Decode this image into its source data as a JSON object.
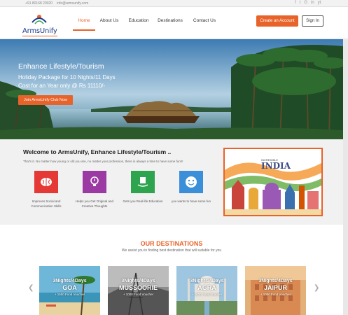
{
  "topbar": {
    "phone": "+91 80168 29020",
    "email": "info@armsunify.com",
    "social": [
      "f",
      "t",
      "G",
      "in",
      "yt"
    ]
  },
  "brand": {
    "name": "ArmsUnify"
  },
  "nav": {
    "items": [
      "Home",
      "About Us",
      "Education",
      "Destinations",
      "Contact Us"
    ],
    "active": "Home"
  },
  "auth": {
    "create_label": "Create an Account",
    "signin_label": "Sign In"
  },
  "hero": {
    "title": "Enhance Lifestyle/Tourism",
    "line1": "Holiday Package for 10 Nights/11 Days",
    "line2": "Cost for an Year only @ Rs 11110/-",
    "cta": "Join ArmsUnify Club Now"
  },
  "welcome": {
    "title": "Welcome to ArmsUnify, Enhance Lifestyle/Tourism ..",
    "desc": "That's it. No matter how young or old you are, no matter your profession, there is always a time to have some fun!!!",
    "features": [
      {
        "label": "Improves Social and Communication Skills",
        "color": "#e53935",
        "icon": "brain-icon"
      },
      {
        "label": "Helps you Get Original and Creative Thoughts",
        "color": "#9c3aa4",
        "icon": "lightbulb-icon"
      },
      {
        "label": "Gets you Real-life Education",
        "color": "#2ea44f",
        "icon": "book-hand-icon"
      },
      {
        "label": "you wants to have some fun",
        "color": "#3a8fd8",
        "icon": "smiley-icon"
      }
    ],
    "india_small": "INCREDIBLE",
    "india_big": "INDIA"
  },
  "destinations": {
    "title": "OUR DESTINATIONS",
    "subtitle": "We assist you in finding best destination that will suitable for you",
    "cards": [
      {
        "duration": "3Nights/4Days",
        "name": "GOA",
        "voucher": "+ 1500 Food Voucher"
      },
      {
        "duration": "3Nights/4Days",
        "name": "MUSSOORIE",
        "voucher": "+ 1000 Food Voucher"
      },
      {
        "duration": "3Nights/4Days",
        "name": "AGRA",
        "voucher": "+ 1000 Food Voucher"
      },
      {
        "duration": "3Nights/4Days",
        "name": "JAIPUR",
        "voucher": "+ 1000 Food Voucher"
      }
    ]
  },
  "colors": {
    "accent": "#e8632a",
    "brand_blue": "#1a3a8a"
  }
}
